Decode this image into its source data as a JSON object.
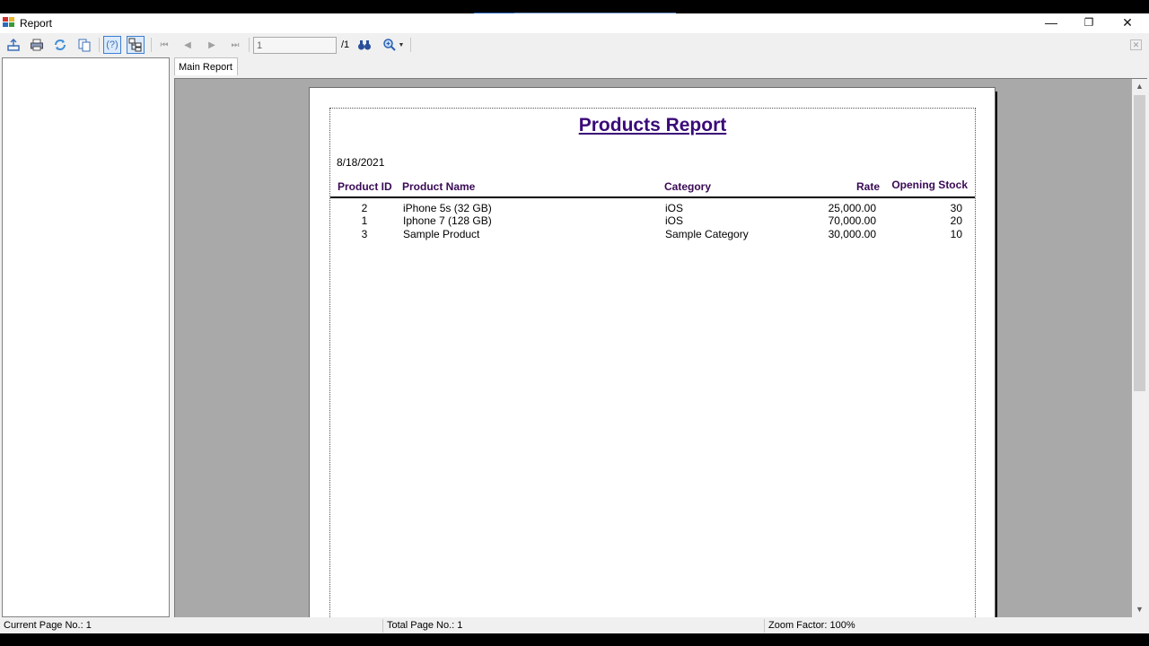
{
  "window": {
    "title": "Report"
  },
  "title_controls": {
    "minimize": "—",
    "restore": "❐",
    "close": "✕"
  },
  "toolbar": {
    "export_icon": "export-icon",
    "print_icon": "printer-icon",
    "refresh_icon": "refresh-icon",
    "copy_icon": "copy-icon",
    "help_label": "(?)",
    "group_tree_icon": "group-tree-icon",
    "first_page": "⏮",
    "prev_page": "◀",
    "next_page": "▶",
    "last_page": "⏭",
    "page_value": "1",
    "page_total": "/1",
    "search_icon": "binoculars-icon",
    "zoom_icon": "zoom-icon",
    "close_label": "✕"
  },
  "tabs": [
    {
      "label": "Main Report"
    }
  ],
  "report": {
    "title": "Products Report",
    "date": "8/18/2021",
    "columns": [
      "Product ID",
      "Product Name",
      "Category",
      "Rate",
      "Opening Stock"
    ],
    "rows": [
      {
        "id": "2",
        "name": "iPhone 5s (32 GB)",
        "category": "iOS",
        "rate": "25,000.00",
        "stock": "30"
      },
      {
        "id": "1",
        "name": "Iphone 7 (128 GB)",
        "category": "iOS",
        "rate": "70,000.00",
        "stock": "20"
      },
      {
        "id": "3",
        "name": "Sample Product",
        "category": "Sample Category",
        "rate": "30,000.00",
        "stock": "10"
      }
    ]
  },
  "status": {
    "current_page": "Current Page No.: 1",
    "total_page": "Total Page No.: 1",
    "zoom": "Zoom Factor: 100%"
  },
  "colors": {
    "title": "#3a0a78",
    "header": "#3a0a55",
    "viewer_bg": "#a9a9a9",
    "accent": "#3d7fd0"
  }
}
